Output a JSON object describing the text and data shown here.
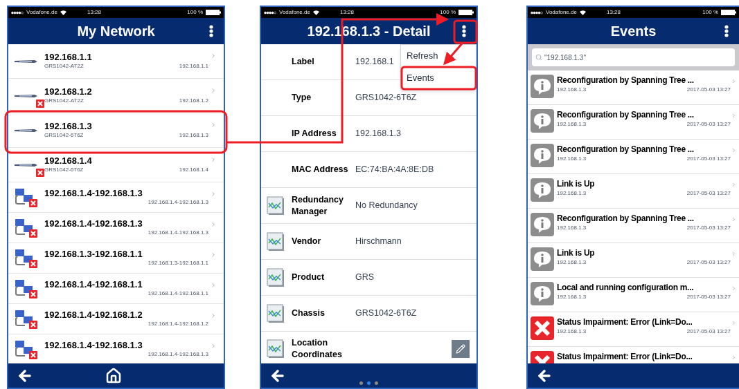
{
  "network_screen": {
    "status_bar": {
      "carrier": "Vodafone.de",
      "time": "13:28",
      "battery": "100 %"
    },
    "title": "My Network",
    "rows": [
      {
        "kind": "switch",
        "error": false,
        "title": "192.168.1.1",
        "model": "GRS1042-AT2Z",
        "address": "192.168.1.1"
      },
      {
        "kind": "switch",
        "error": true,
        "title": "192.168.1.2",
        "model": "GRS1042-AT2Z",
        "address": "192.168.1.2"
      },
      {
        "kind": "switch",
        "error": false,
        "title": "192.168.1.3",
        "model": "GRS1042-6T6Z",
        "address": "192.168.1.3"
      },
      {
        "kind": "switch",
        "error": true,
        "title": "192.168.1.4",
        "model": "GRS1042-6T6Z",
        "address": "192.168.1.4"
      },
      {
        "kind": "link",
        "error": true,
        "title": "192.168.1.4-192.168.1.3",
        "address": "192.168.1.4-192.168.1.3"
      },
      {
        "kind": "link",
        "error": true,
        "title": "192.168.1.4-192.168.1.3",
        "address": "192.168.1.4-192.168.1.3"
      },
      {
        "kind": "link",
        "error": true,
        "title": "192.168.1.3-192.168.1.1",
        "address": "192.168.1.3-192.168.1.1"
      },
      {
        "kind": "link",
        "error": true,
        "title": "192.168.1.4-192.168.1.1",
        "address": "192.168.1.4-192.168.1.1"
      },
      {
        "kind": "link",
        "error": true,
        "title": "192.168.1.4-192.168.1.2",
        "address": "192.168.1.4-192.168.1.2"
      },
      {
        "kind": "link",
        "error": true,
        "title": "192.168.1.4-192.168.1.3",
        "address": "192.168.1.4-192.168.1.3"
      }
    ]
  },
  "detail_screen": {
    "status_bar": {
      "carrier": "Vodafone.de",
      "time": "13:28",
      "battery": "100 %"
    },
    "title": "192.168.1.3 - Detail",
    "menu": [
      "Refresh",
      "Events"
    ],
    "rows": [
      {
        "kind": "plain",
        "editable": false,
        "label": "Label",
        "value": "192.168.1"
      },
      {
        "kind": "plain",
        "editable": false,
        "label": "Type",
        "value": "GRS1042-6T6Z"
      },
      {
        "kind": "plain",
        "editable": false,
        "label": "IP Address",
        "value": "192.168.1.3"
      },
      {
        "kind": "plain",
        "editable": false,
        "label": "MAC Address",
        "value": "EC:74:BA:4A:8E:DB"
      },
      {
        "kind": "chart",
        "editable": false,
        "label": "Redundancy Manager",
        "value": "No Redundancy"
      },
      {
        "kind": "chart",
        "editable": false,
        "label": "Vendor",
        "value": "Hirschmann"
      },
      {
        "kind": "chart",
        "editable": false,
        "label": "Product",
        "value": "GRS"
      },
      {
        "kind": "chart",
        "editable": false,
        "label": "Chassis",
        "value": "GRS1042-6T6Z"
      },
      {
        "kind": "chart",
        "editable": true,
        "label": "Location Coordinates"
      }
    ],
    "pager": [
      {
        "selected": false
      },
      {
        "selected": true
      },
      {
        "selected": false
      }
    ]
  },
  "events_screen": {
    "status_bar": {
      "carrier": "Vodafone.de",
      "time": "13:28",
      "battery": "100 %"
    },
    "title": "Events",
    "search": {
      "value": "\"192.168.1.3\""
    },
    "events": [
      {
        "kind": "info",
        "title": "Reconfiguration by Spanning Tree ...",
        "source": "192.168.1.3",
        "time": "2017-05-03 13:27"
      },
      {
        "kind": "info",
        "title": "Reconfiguration by Spanning Tree ...",
        "source": "192.168.1.3",
        "time": "2017-05-03 13:27"
      },
      {
        "kind": "info",
        "title": "Reconfiguration by Spanning Tree ...",
        "source": "192.168.1.3",
        "time": "2017-05-03 13:27"
      },
      {
        "kind": "info",
        "title": "Link is Up",
        "source": "192.168.1.3",
        "time": "2017-05-03 13:27"
      },
      {
        "kind": "info",
        "title": "Reconfiguration by Spanning Tree ...",
        "source": "192.168.1.3",
        "time": "2017-05-03 13:27"
      },
      {
        "kind": "info",
        "title": "Link is Up",
        "source": "192.168.1.3",
        "time": "2017-05-03 13:27"
      },
      {
        "kind": "info",
        "title": "Local and running configuration m...",
        "source": "192.168.1.3",
        "time": "2017-05-03 13:27"
      },
      {
        "kind": "error",
        "title": "Status Impairment: Error (Link=Do...",
        "source": "192.168.1.3",
        "time": "2017-05-03 13:27"
      },
      {
        "kind": "error",
        "title": "Status Impairment: Error (Link=Do..."
      }
    ]
  }
}
